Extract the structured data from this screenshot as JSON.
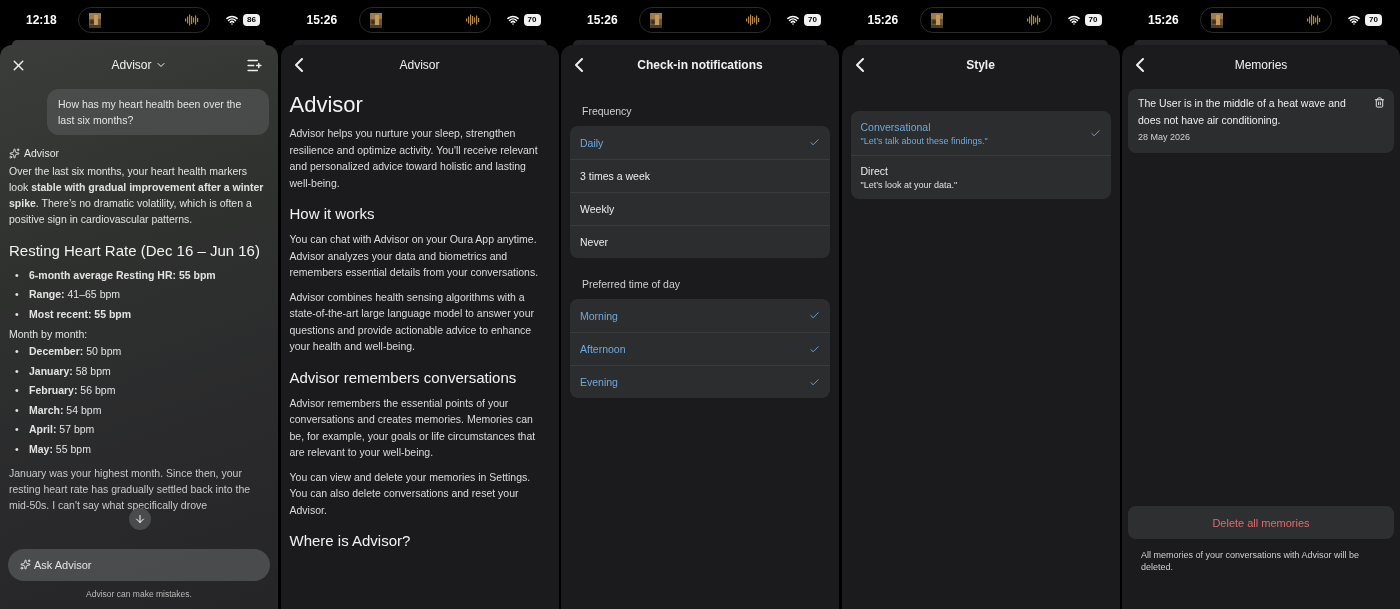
{
  "screens": [
    {
      "kind": "chat",
      "time": "12:18",
      "battery": "86",
      "title": "Advisor",
      "question": "How has my heart health been over the last six months?",
      "sender": "Advisor",
      "intro": "Over the last six months, your heart health markers look **stable with gradual improvement after a winter spike**. There’s no dramatic volatility, which is often a positive sign in cardiovascular patterns.",
      "heading": "Resting Heart Rate (Dec 16 – Jun 16)",
      "bullet": "•",
      "summary": [
        "**6-month average Resting HR: 55 bpm**",
        "**Range:** 41–65 bpm",
        "**Most recent: 55 bpm**"
      ],
      "subheading": "Month by month:",
      "months": [
        "**December:** 50 bpm",
        "**January:** 58 bpm",
        "**February:** 56 bpm",
        "**March:** 54 bpm",
        "**April:** 57 bpm",
        "**May:** 55 bpm"
      ],
      "closing": "January was your highest month. Since then, your resting heart rate has gradually settled back into the mid-50s. I can't say what specifically drove",
      "placeholder": "Ask Advisor",
      "disclaimer": "Advisor can make mistakes."
    },
    {
      "kind": "article",
      "time": "15:26",
      "battery": "70",
      "title": "Advisor",
      "blocks": [
        {
          "kind": "title",
          "text": "Advisor"
        },
        {
          "kind": "paragraph",
          "text": "Advisor helps you nurture your sleep, strengthen resilience and optimize activity. You'll receive relevant and personalized advice toward holistic and lasting well-being."
        },
        {
          "kind": "heading",
          "text": "How it works"
        },
        {
          "kind": "paragraph",
          "text": "You can chat with Advisor on your Oura App anytime. Advisor analyzes your data and biometrics and remembers essential details from your conversations."
        },
        {
          "kind": "paragraph",
          "text": "Advisor combines health sensing algorithms with a state-of-the-art large language model to answer your questions and provide actionable advice to enhance your health and well-being."
        },
        {
          "kind": "heading",
          "text": "Advisor remembers conversations"
        },
        {
          "kind": "paragraph",
          "text": "Advisor remembers the essential points of your conversations and creates memories. Memories can be, for example, your goals or life circumstances that are relevant to your well-being."
        },
        {
          "kind": "paragraph",
          "text": "You can view and delete your memories in Settings. You can also delete conversations and reset your Advisor."
        },
        {
          "kind": "heading",
          "text": "Where is Advisor?"
        }
      ]
    },
    {
      "kind": "options",
      "time": "15:26",
      "battery": "70",
      "title": "Check-in notifications",
      "sections": [
        {
          "label": "Frequency",
          "options": [
            {
              "label": "Daily",
              "selected": true
            },
            {
              "label": "3 times a week",
              "selected": false
            },
            {
              "label": "Weekly",
              "selected": false
            },
            {
              "label": "Never",
              "selected": false
            }
          ]
        },
        {
          "label": "Preferred time of day",
          "options": [
            {
              "label": "Morning",
              "checked": true
            },
            {
              "label": "Afternoon",
              "checked": true
            },
            {
              "label": "Evening",
              "checked": true
            }
          ]
        }
      ]
    },
    {
      "kind": "styles",
      "time": "15:26",
      "battery": "70",
      "title": "Style",
      "options": [
        {
          "label": "Conversational",
          "example": "\"Let’s talk about these findings.\"",
          "selected": true
        },
        {
          "label": "Direct",
          "example": "\"Let’s look at your data.\"",
          "selected": false
        }
      ]
    },
    {
      "kind": "memories",
      "time": "15:26",
      "battery": "70",
      "title": "Memories",
      "memories": [
        {
          "text": "The User is in the middle of a heat wave and does not have air conditioning.",
          "date": "28 May 2026"
        }
      ],
      "delete_label": "Delete all memories",
      "note": "All memories of your conversations with Advisor will be deleted."
    }
  ]
}
